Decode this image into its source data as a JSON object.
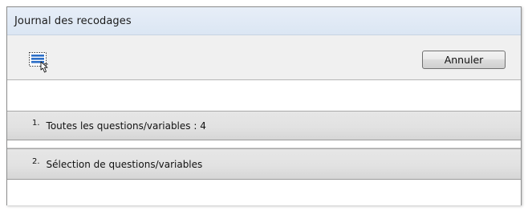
{
  "window": {
    "title": "Journal des recodages"
  },
  "toolbar": {
    "icon": "select-list-pointer-icon",
    "cancel_label": "Annuler"
  },
  "items": [
    {
      "number": "1.",
      "label": "Toutes les questions/variables : 4"
    },
    {
      "number": "2.",
      "label": "Sélection de questions/variables"
    }
  ],
  "colors": {
    "titlebar": "#dfe8f4",
    "toolbar": "#f0f0f0",
    "row": "#e2e2e2"
  }
}
